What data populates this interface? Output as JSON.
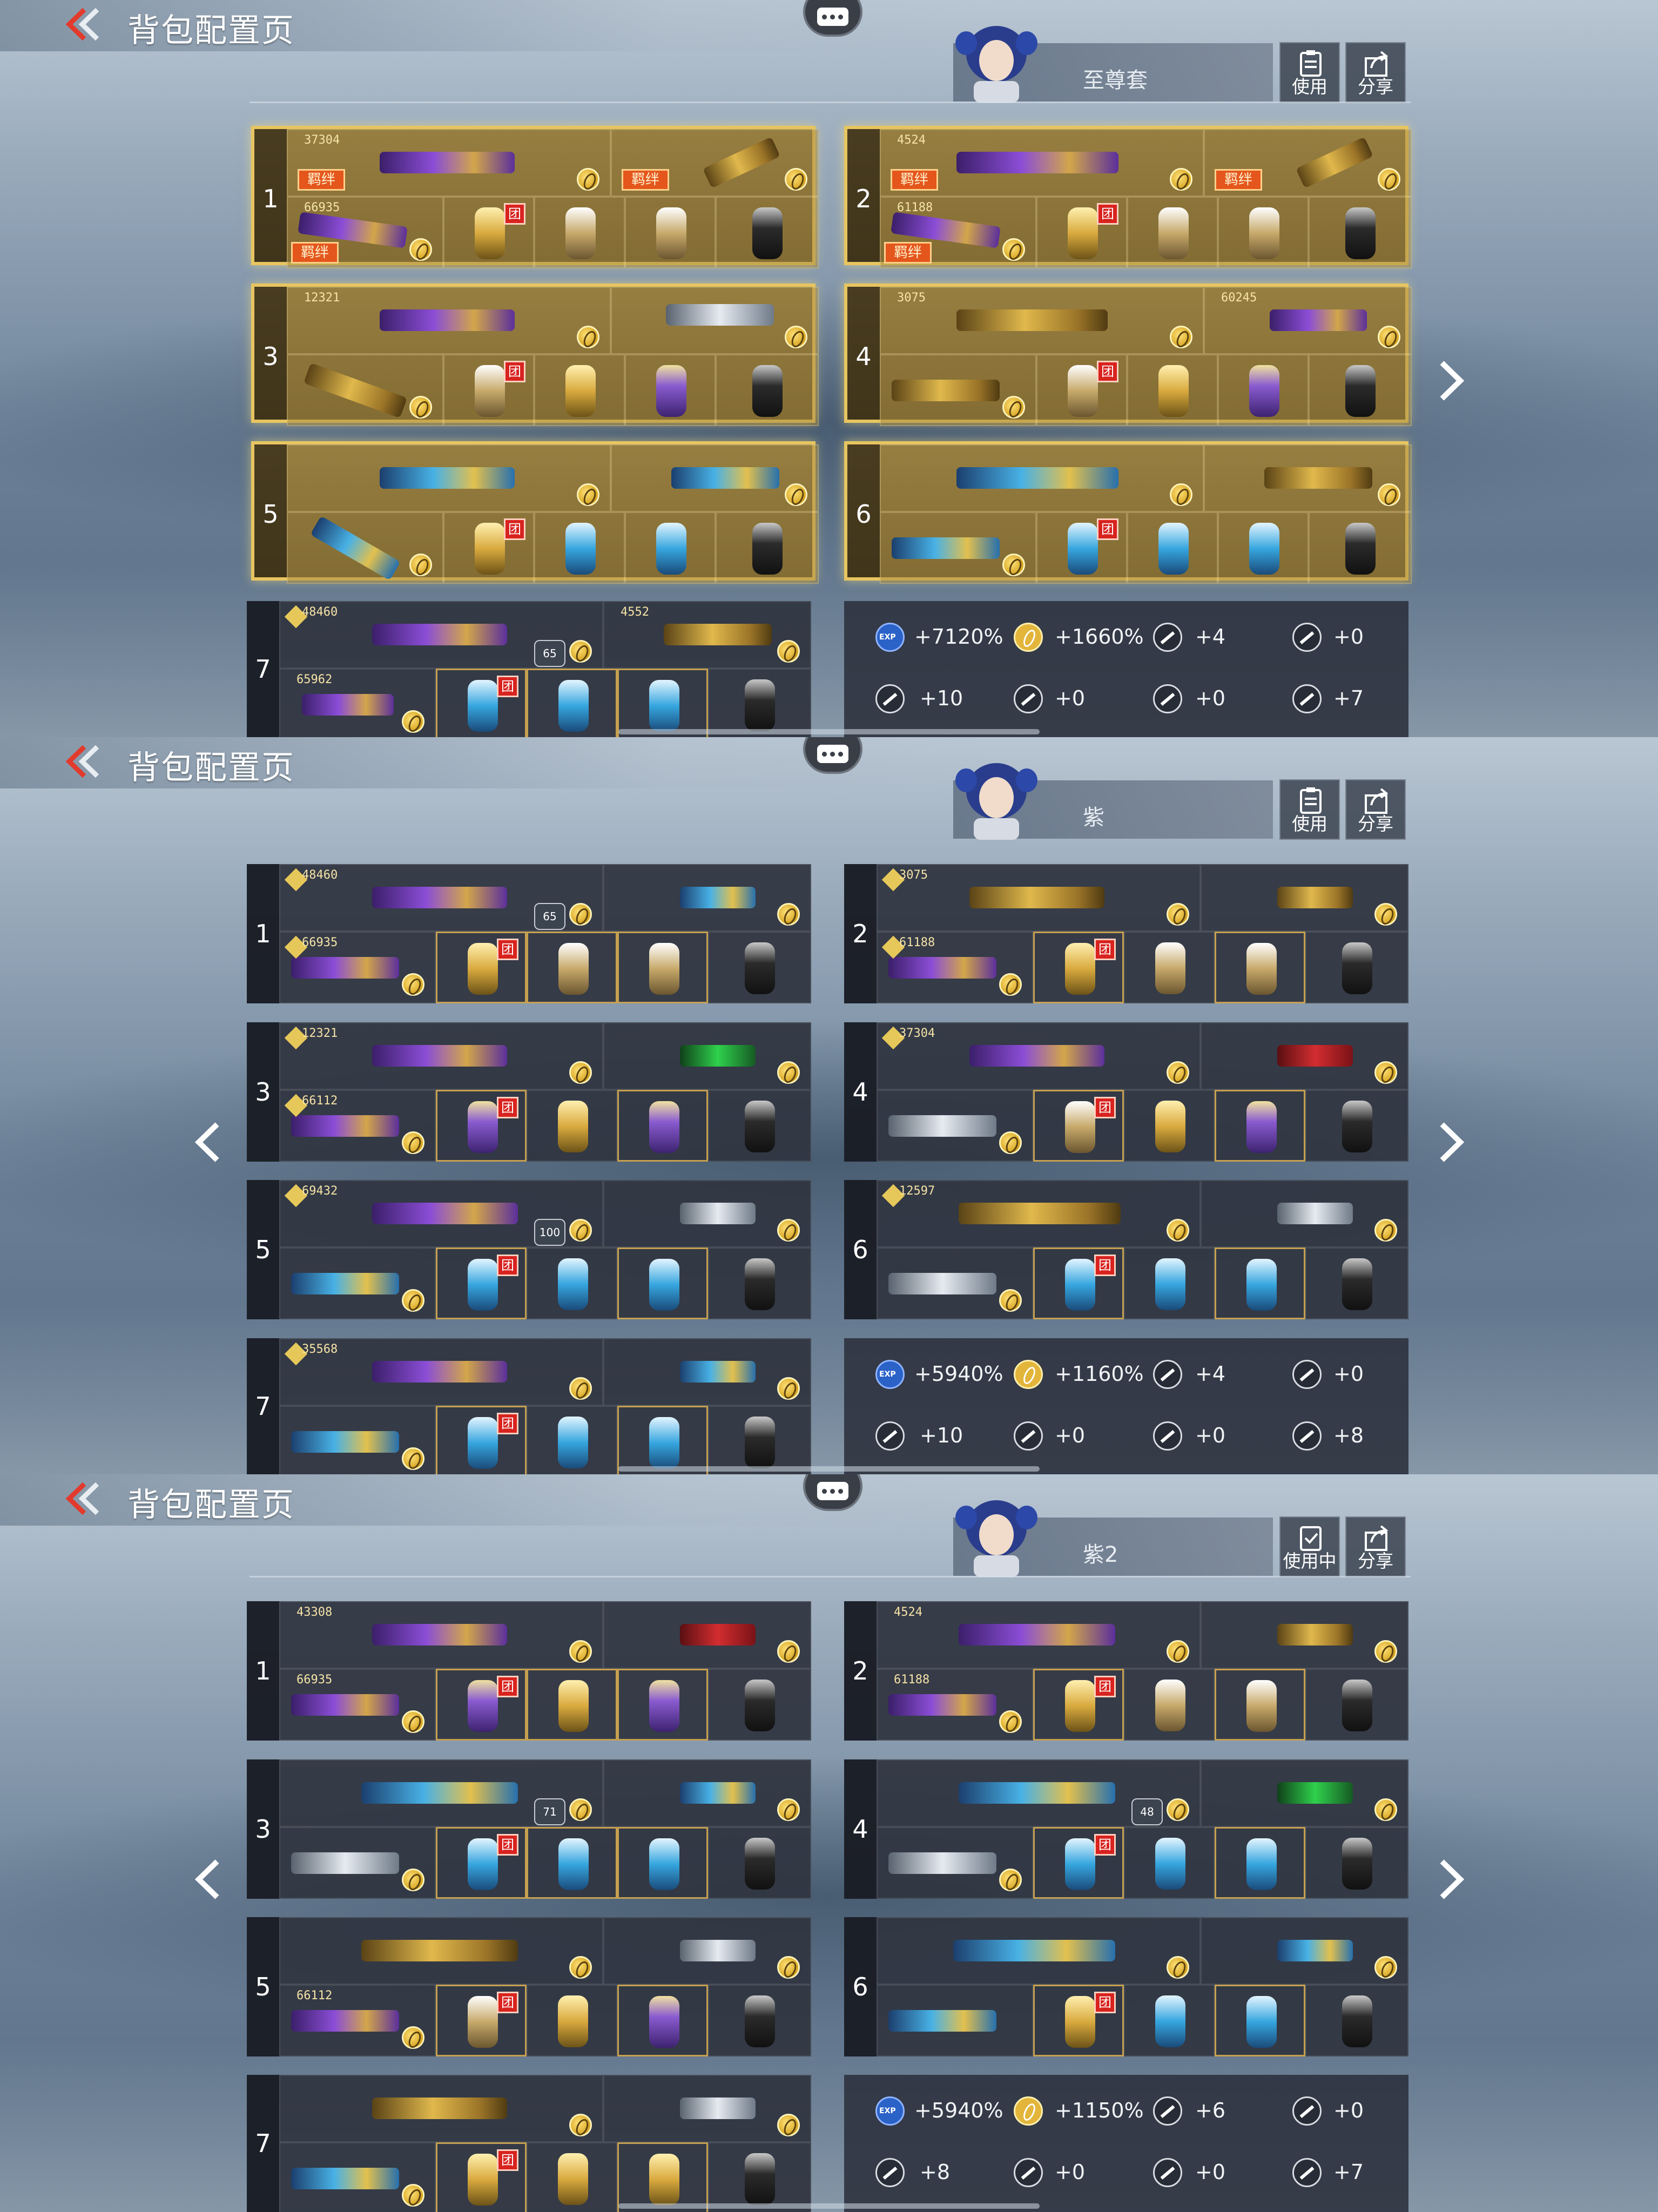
{
  "screens": [
    {
      "title": "背包配置页",
      "preset_name": "至尊套",
      "actions": {
        "use": "使用",
        "share": "分享"
      },
      "loadouts": [
        {
          "num": "1",
          "main_score": "37304",
          "melee_score": "66935",
          "gold": true,
          "bond": true
        },
        {
          "num": "2",
          "main_score": "4524",
          "melee_score": "61188",
          "gold": true,
          "bond": true
        },
        {
          "num": "3",
          "main_score": "12321",
          "melee_score": "",
          "gold": true
        },
        {
          "num": "4",
          "main_score": "3075",
          "side_score": "60245",
          "gold": true
        },
        {
          "num": "5",
          "main_score": "",
          "gold": true
        },
        {
          "num": "6",
          "main_score": "",
          "gold": true
        },
        {
          "num": "7",
          "main_score": "48460",
          "side_score": "4552",
          "melee_score": "65962",
          "badge": "65"
        }
      ],
      "stats": {
        "exp": "+7120%",
        "gold": "+1660%",
        "s3": "+4",
        "s4": "+0",
        "s5": "+10",
        "s6": "+0",
        "s7": "+0",
        "s8": "+7"
      }
    },
    {
      "title": "背包配置页",
      "preset_name": "紫",
      "actions": {
        "use": "使用",
        "share": "分享"
      },
      "loadouts": [
        {
          "num": "1",
          "main_score": "48460",
          "melee_score": "66935",
          "badge": "65"
        },
        {
          "num": "2",
          "main_score": "3075",
          "melee_score": "61188"
        },
        {
          "num": "3",
          "main_score": "12321",
          "melee_score": "66112"
        },
        {
          "num": "4",
          "main_score": "37304"
        },
        {
          "num": "5",
          "main_score": "69432",
          "badge": "100"
        },
        {
          "num": "6",
          "main_score": "12597"
        },
        {
          "num": "7",
          "main_score": "35568"
        }
      ],
      "stats": {
        "exp": "+5940%",
        "gold": "+1160%",
        "s3": "+4",
        "s4": "+0",
        "s5": "+10",
        "s6": "+0",
        "s7": "+0",
        "s8": "+8"
      }
    },
    {
      "title": "背包配置页",
      "preset_name": "紫2",
      "actions": {
        "use": "使用中",
        "share": "分享"
      },
      "loadouts": [
        {
          "num": "1",
          "main_score": "43308",
          "melee_score": "66935"
        },
        {
          "num": "2",
          "main_score": "4524",
          "melee_score": "61188"
        },
        {
          "num": "3",
          "badge": "71"
        },
        {
          "num": "4",
          "badge": "48"
        },
        {
          "num": "5",
          "melee_score": "66112"
        },
        {
          "num": "6"
        },
        {
          "num": "7"
        }
      ],
      "stats": {
        "exp": "+5940%",
        "gold": "+1150%",
        "s3": "+6",
        "s4": "+0",
        "s5": "+8",
        "s6": "+0",
        "s7": "+0",
        "s8": "+7"
      }
    }
  ],
  "bond_label": "羁绊",
  "team_tag": "团",
  "icons": [
    "back-chevron-icon",
    "chat-bubble-icon",
    "clipboard-use-icon",
    "share-icon",
    "exp-icon",
    "gold-coin-icon",
    "bullet-icon",
    "gun-icon",
    "pistol-icon",
    "arrow-left-icon",
    "arrow-right-icon"
  ],
  "colors": {
    "accent_gold": "#e7c560",
    "card_bg": "#2c313c",
    "team_red": "#d8231f"
  }
}
